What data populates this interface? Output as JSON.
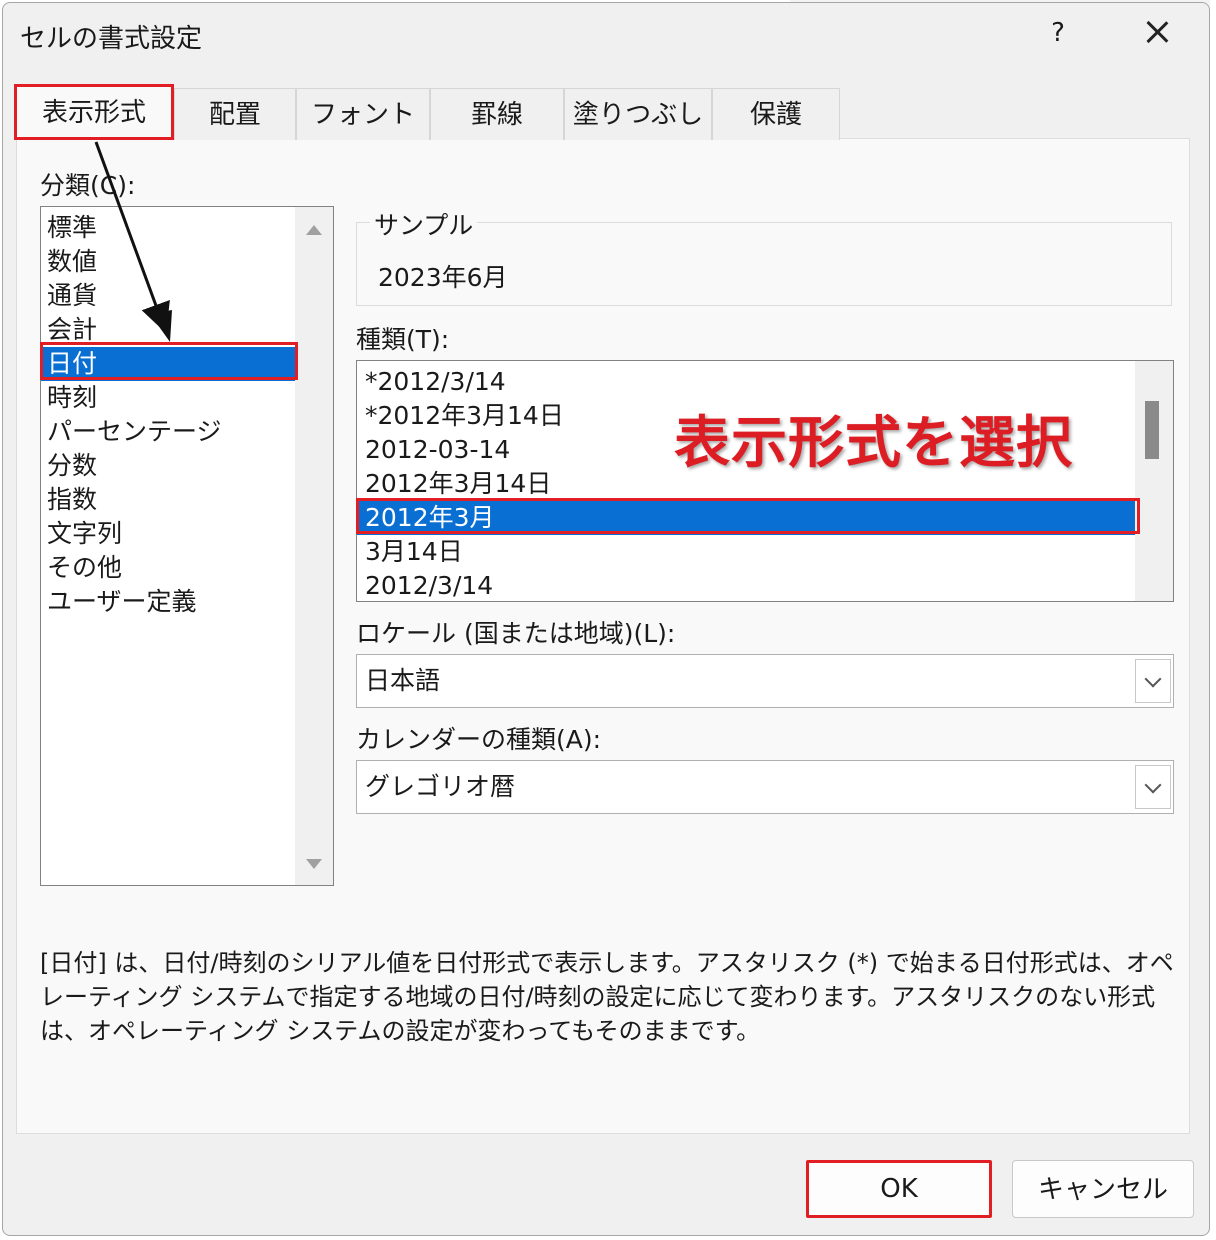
{
  "dialog": {
    "title": "セルの書式設定",
    "help": "?"
  },
  "tabs": [
    "表示形式",
    "配置",
    "フォント",
    "罫線",
    "塗りつぶし",
    "保護"
  ],
  "category": {
    "label": "分類(C):",
    "items": [
      "標準",
      "数値",
      "通貨",
      "会計",
      "日付",
      "時刻",
      "パーセンテージ",
      "分数",
      "指数",
      "文字列",
      "その他",
      "ユーザー定義"
    ],
    "selected": "日付"
  },
  "sample": {
    "legend": "サンプル",
    "value": "2023年6月"
  },
  "type": {
    "label": "種類(T):",
    "items": [
      "*2012/3/14",
      "*2012年3月14日",
      "2012-03-14",
      "2012年3月14日",
      "2012年3月",
      "3月14日",
      "2012/3/14"
    ],
    "selected": "2012年3月"
  },
  "locale": {
    "label": "ロケール (国または地域)(L):",
    "value": "日本語"
  },
  "calendar": {
    "label": "カレンダーの種類(A):",
    "value": "グレゴリオ暦"
  },
  "description": "[日付] は、日付/時刻のシリアル値を日付形式で表示します。アスタリスク (*) で始まる日付形式は、オペレーティング システムで指定する地域の日付/時刻の設定に応じて変わります。アスタリスクのない形式は、オペレーティング システムの設定が変わってもそのままです。",
  "annotation": "表示形式を選択",
  "buttons": {
    "ok": "OK",
    "cancel": "キャンセル"
  },
  "colors": {
    "highlight": "#e01e24",
    "selection": "#0a6fd3"
  }
}
